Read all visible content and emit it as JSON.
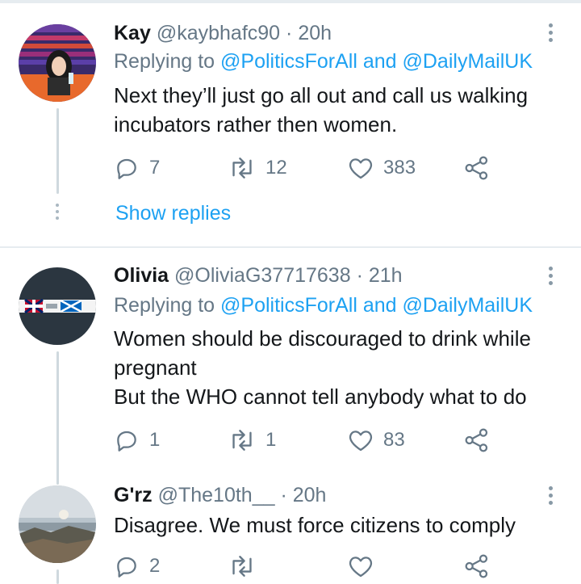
{
  "tweets": [
    {
      "name": "Kay",
      "handle": "@kaybhafc90",
      "sep": "·",
      "time": "20h",
      "replying_prefix": "Replying to ",
      "replying_to_1": "@PoliticsForAll",
      "replying_and": " and ",
      "replying_to_2": "@DailyMailUK",
      "text_lines": [
        "Next they’ll just go all out and call us walking",
        "incubators rather then women."
      ],
      "replies": "7",
      "retweets": "12",
      "likes": "383",
      "show_replies": "Show replies"
    },
    {
      "name": "Olivia",
      "handle": "@OliviaG37717638",
      "sep": "·",
      "time": "21h",
      "replying_prefix": "Replying to ",
      "replying_to_1": "@PoliticsForAll",
      "replying_and": " and ",
      "replying_to_2": "@DailyMailUK",
      "text_lines": [
        "Women should be discouraged to drink while",
        "pregnant",
        "But the WHO cannot tell anybody what to do"
      ],
      "replies": "1",
      "retweets": "1",
      "likes": "83"
    },
    {
      "name": "G'rz",
      "handle": "@The10th__",
      "sep": "·",
      "time": "20h",
      "text_lines": [
        "Disagree. We must force citizens to comply"
      ],
      "replies": "2",
      "retweets": "",
      "likes": ""
    }
  ],
  "icons": {
    "reply": "reply-icon",
    "retweet": "retweet-icon",
    "like": "heart-icon",
    "share": "share-icon",
    "more": "more-vertical-icon"
  },
  "colors": {
    "link": "#1da1f2",
    "secondary": "#657786",
    "text": "#14171a",
    "divider": "#e6ecf0"
  }
}
